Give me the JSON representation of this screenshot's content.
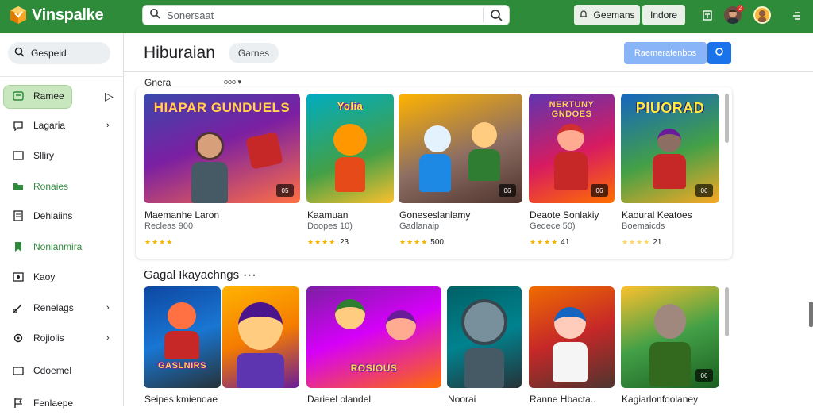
{
  "app": {
    "name": "Vinspalke"
  },
  "search": {
    "placeholder": "Sonersaat"
  },
  "topbar": {
    "buttons": [
      {
        "label": "Geemans"
      },
      {
        "label": "Indore"
      }
    ],
    "notification_count": "2"
  },
  "sidebar": {
    "search_label": "Gespeid",
    "items": [
      {
        "label": "Ramee",
        "icon": "controller-icon"
      },
      {
        "label": "Lagaria",
        "icon": "chat-icon"
      },
      {
        "label": "Slliry",
        "icon": "monitor-icon"
      },
      {
        "label": "Ronaies",
        "icon": "folder-icon"
      },
      {
        "label": "Dehlaiins",
        "icon": "document-icon"
      },
      {
        "label": "Nonlanmira",
        "icon": "bookmark-icon"
      },
      {
        "label": "Kaoy",
        "icon": "media-icon"
      },
      {
        "label": "Renelags",
        "icon": "brush-icon"
      },
      {
        "label": "Rojiolis",
        "icon": "settings-icon"
      },
      {
        "label": "Cdoemel",
        "icon": "card-icon"
      },
      {
        "label": "Fenlaepe",
        "icon": "flag-icon"
      }
    ]
  },
  "header": {
    "title": "Hiburaian",
    "chip": "Garnes",
    "primary_button": "Raemeratenbos"
  },
  "section1": {
    "sort_label": "Gnera",
    "sort_value": "ooo",
    "cards": [
      {
        "art_title": "HIAPAR GUNDUELS",
        "badge": "05",
        "title": "Maemanhe Laron",
        "subtitle": "Recleas 900",
        "rating": "★★★★",
        "count": ""
      },
      {
        "art_title": "Yolia",
        "badge": "",
        "title": "Kaamuan",
        "subtitle": "Doopes 10)",
        "rating": "",
        "count": ""
      },
      {
        "art_title": "",
        "badge": "06",
        "title": "Goneseslanlamy",
        "subtitle": "Gadlanaip",
        "rating": "★★★★",
        "count": "500"
      },
      {
        "art_title": "NERTUNY GNDOES",
        "badge": "06",
        "title": "Deaote Sonlakiy",
        "subtitle": "Gedece 50)",
        "rating": "★★★★",
        "count": "41"
      },
      {
        "art_title": "PIUORAD",
        "badge": "06",
        "title": "Kaoural Keatoes",
        "subtitle": "Boemaicds",
        "rating": "★★★★",
        "count": "21"
      }
    ],
    "first_rating_count": "23"
  },
  "section2": {
    "title": "Gagal Ikayachngs",
    "more": "• • •",
    "cards": [
      {
        "art_title": "GASLNIRS",
        "title": "Seipes kmienoae"
      },
      {
        "art_title": "",
        "title": ""
      },
      {
        "art_title": "ROSIOUS",
        "title": "Darieel olandel"
      },
      {
        "art_title": "",
        "title": "Noorai"
      },
      {
        "art_title": "",
        "title": "Ranne Hbacta.."
      },
      {
        "art_title": "",
        "badge": "06",
        "title": "Kagiarlonfoolaney"
      }
    ]
  },
  "colors": {
    "brand": "#2e8b3a",
    "accent": "#1a73e8",
    "star": "#f4b400"
  }
}
